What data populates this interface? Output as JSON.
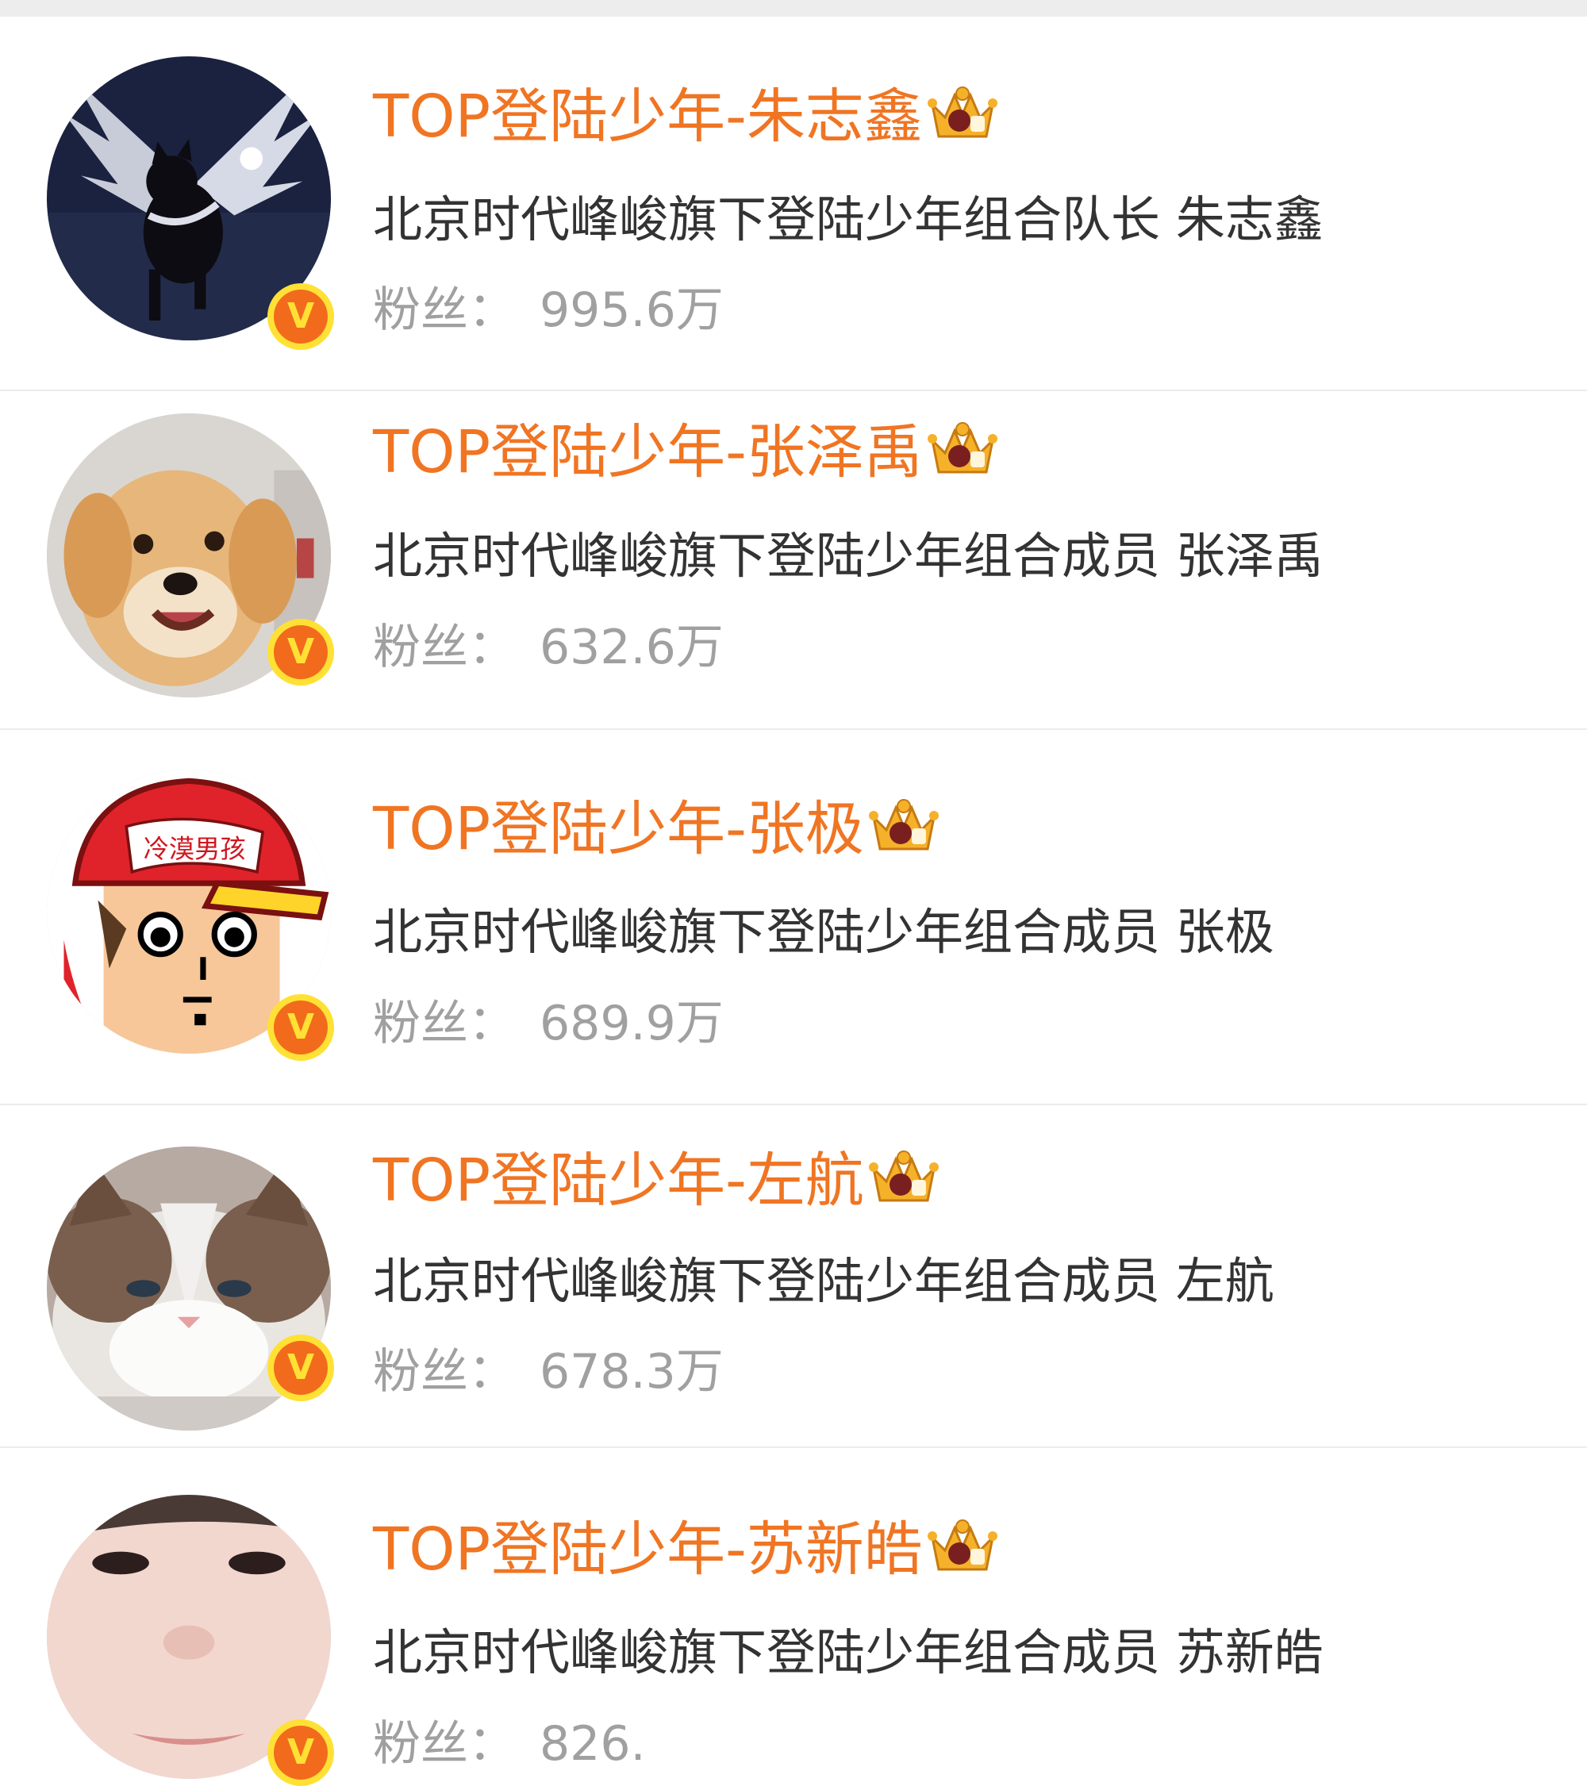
{
  "colors": {
    "name": "#f07523",
    "description": "#333333",
    "fans": "#a0a0a0",
    "divider": "#ececec",
    "verified_badge": "#f26b1d",
    "verified_ring": "#ffe135"
  },
  "accounts": [
    {
      "name": "TOP登陆少年-朱志鑫",
      "description": "北京时代峰峻旗下登陆少年组合队长 朱志鑫",
      "fans_label": "粉丝：",
      "fans_value": "995.6万",
      "avatar": "winged-black-cat",
      "verified": "V"
    },
    {
      "name": "TOP登陆少年-张泽禹",
      "description": "北京时代峰峻旗下登陆少年组合成员 张泽禹",
      "fans_label": "粉丝：",
      "fans_value": "632.6万",
      "avatar": "golden-puppy",
      "verified": "V"
    },
    {
      "name": "TOP登陆少年-张极",
      "description": "北京时代峰峻旗下登陆少年组合成员 张极",
      "fans_label": "粉丝：",
      "fans_value": "689.9万",
      "avatar": "cartoon-boy-red-cap",
      "avatar_cap_text": "冷漠男孩",
      "verified": "V"
    },
    {
      "name": "TOP登陆少年-左航",
      "description": "北京时代峰峻旗下登陆少年组合成员 左航",
      "fans_label": "粉丝：",
      "fans_value": "678.3万",
      "avatar": "ragdoll-cat",
      "verified": "V"
    },
    {
      "name": "TOP登陆少年-苏新皓",
      "description": "北京时代峰峻旗下登陆少年组合成员 苏新皓",
      "fans_label": "粉丝：",
      "fans_value": "826.",
      "avatar": "face-closeup",
      "verified": "V"
    }
  ],
  "icons": {
    "crown": "crown-badge-icon",
    "verified": "verified-v-icon"
  }
}
